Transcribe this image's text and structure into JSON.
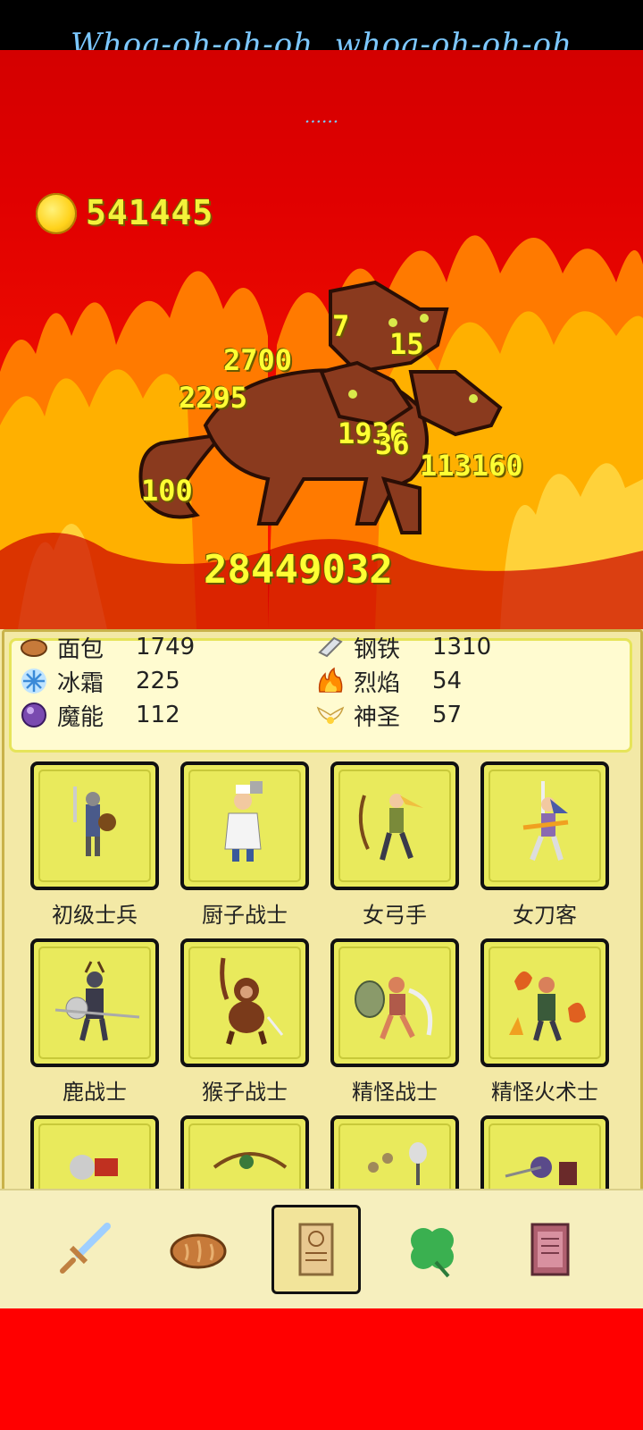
{
  "lyrics": {
    "line1": "Whoa-oh-oh-oh, whoa-oh-oh-oh",
    "line2": "......"
  },
  "gold": "541445",
  "damage_numbers": [
    "7",
    "15",
    "2700",
    "2295",
    "1936",
    "36",
    "113160",
    "100",
    "28449032"
  ],
  "resources": [
    {
      "icon": "bread-icon",
      "name": "面包",
      "value": "1749"
    },
    {
      "icon": "steel-icon",
      "name": "钢铁",
      "value": "1310"
    },
    {
      "icon": "frost-icon",
      "name": "冰霜",
      "value": "225"
    },
    {
      "icon": "flame-icon",
      "name": "烈焰",
      "value": "54"
    },
    {
      "icon": "magic-orb-icon",
      "name": "魔能",
      "value": "112"
    },
    {
      "icon": "holy-wings-icon",
      "name": "神圣",
      "value": "57"
    }
  ],
  "units": [
    {
      "name": "初级士兵"
    },
    {
      "name": "厨子战士"
    },
    {
      "name": "女弓手"
    },
    {
      "name": "女刀客"
    },
    {
      "name": "鹿战士"
    },
    {
      "name": "猴子战士"
    },
    {
      "name": "精怪战士"
    },
    {
      "name": "精怪火术士"
    }
  ],
  "nav": [
    {
      "icon": "sword-icon"
    },
    {
      "icon": "bread-icon"
    },
    {
      "icon": "scroll-icon",
      "active": true
    },
    {
      "icon": "clover-icon"
    },
    {
      "icon": "book-icon"
    }
  ],
  "colors": {
    "lyric": "#7cc8ff",
    "damage": "#ffff33",
    "card": "#e9ea5c",
    "panel": "#f3e9a6"
  }
}
